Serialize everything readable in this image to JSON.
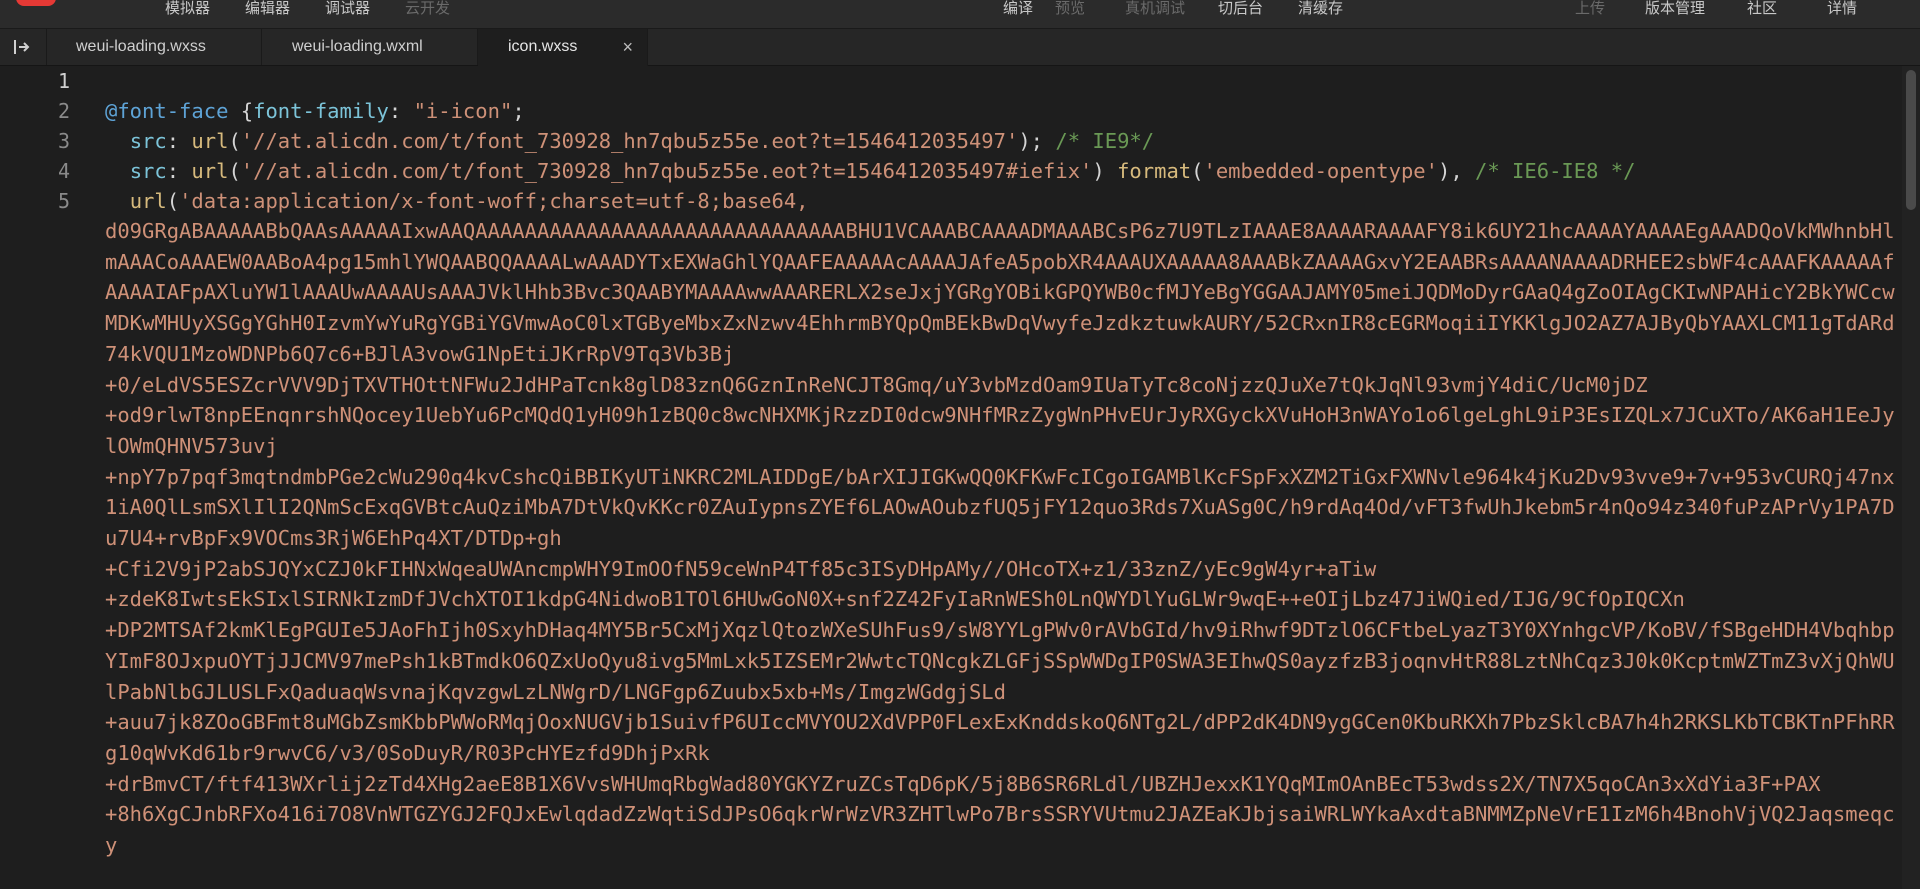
{
  "toolbar": {
    "simulator": "模拟器",
    "editor": "编辑器",
    "debugger": "调试器",
    "cloud_dev": "云开发",
    "compile": "编译",
    "preview": "预览",
    "remote_debug": "真机调试",
    "background": "切后台",
    "clear_cache": "清缓存",
    "upload": "上传",
    "version_mgmt": "版本管理",
    "community": "社区",
    "details": "详情"
  },
  "tabs": [
    {
      "label": "weui-loading.wxss"
    },
    {
      "label": "weui-loading.wxml"
    },
    {
      "label": "icon.wxss",
      "close": "×"
    }
  ],
  "gutter": [
    "1",
    "2",
    "3",
    "4",
    "5"
  ],
  "code": {
    "l2": {
      "at": "@font-face",
      "rest1": " {",
      "prop": "font-family",
      "rest2": ": ",
      "str": "\"i-icon\"",
      "end": ";"
    },
    "l3": {
      "indent": "  ",
      "prop": "src",
      "colon": ": ",
      "fn": "url",
      "open": "(",
      "str": "'//at.alicdn.com/t/font_730928_hn7qbu5z55e.eot?t=1546412035497'",
      "close": "); ",
      "cmt": "/* IE9*/"
    },
    "l4": {
      "indent": "  ",
      "prop": "src",
      "colon": ": ",
      "fn": "url",
      "open": "(",
      "str": "'//at.alicdn.com/t/font_730928_hn7qbu5z55e.eot?t=1546412035497#iefix'",
      "mid": ") ",
      "fn2": "format",
      "open2": "(",
      "str2": "'embedded-opentype'",
      "close2": "), ",
      "cmt": "/* IE6-IE8 */"
    },
    "l5": {
      "indent": "  ",
      "fn": "url",
      "open": "(",
      "str": "'data:application/x-font-woff;charset=utf-8;base64,"
    },
    "base64": "d09GRgABAAAAABbQAAsAAAAAIxwAAQAAAAAAAAAAAAAAAAAAAAAAAAAAAAAABHU1VCAAABCAAAADMAAABCsP6z7U9TLzIAAAE8AAAARAAAAFY8ik6UY21hcAAAAYAAAAEgAAADQoVkMWhnbHlmAAACoAAAEW0AABoA4pg15mhlYWQAABQQAAAALwAAADYTxEXWaGhlYQAAFEAAAAAcAAAAJAfeA5pobXR4AAAUXAAAAA8AAABkZAAAAGxvY2EAABRsAAAANAAAADRHEE2sbWF4cAAAFKAAAAAfAAAAIAFpAXluYW1lAAAUwAAAAUsAAAJVklHhb3Bvc3QAABYMAAAAwwAAARERLX2seJxjYGRgYOBikGPQYWB0cfMJYeBgYGGAAJAMY05meiJQDMoDyrGAaQ4gZoOIAgCKIwNPAHicY2BkYWCcwMDKwMHUyXSGgYGhH0IzvmYwYuRgYGBiYGVmwAoC0lxTGByeMbxZxNzwv4EhhrmBYQpQmBEkBwDqVwyfeJzdkztuwkAURY/52CRxnIR8cEGRMoqiiIYKKlgJO2AZ7AJByQbYAAXLCM11gTdARd74kVQU1MzoWDNPb6Q7c6+BJlA3vowG1NpEtiJKrRpV9Tq3Vb3Bj\n+0/eLdVS5ESZcrVVV9DjTXVTHOttNFWu2JdHPaTcnk8glD83znQ6GznInReNCJT8Gmq/uY3vbMzdOam9IUaTyTc8coNjzzQJuXe7tQkJqNl93vmjY4diC/UcM0jDZ\n+od9rlwT8npEEnqnrshNQocey1UebYu6PcMQdQ1yH09h1zBQ0c8wcNHXMKjRzzDI0dcw9NHfMRzZygWnPHvEUrJyRXGyckXVuHoH3nWAYo1o6lgeLghL9iP3EsIZQLx7JCuXTo/AK6aH1EeJylOWmQHNV573uvj\n+npY7p7pqf3mqtndmbPGe2cWu290q4kvCshcQiBBIKyUTiNKRC2MLAIDDgE/bArXIJIGKwQQ0KFKwFcICgoIGAMBlKcFSpFxXZM2TiGxFXWNvle964k4jKu2Dv93vve9+7v+953vCURQj47nx1iA0QlLsmSXlIlI2QNmScExqGVBtcAuQziMbA7DtVkQvKKcr0ZAuIypnsZYEf6LAOwAOubzfUQ5jFY12quo3Rds7XuASg0C/h9rdAq4Od/vFT3fwUhJkebm5r4nQo94z340fuPzAPrVy1PA7Du7U4+rvBpFx9VOCms3RjW6EhPq4XT/DTDp+gh\n+Cfi2V9jP2abSJQYxCZJ0kFIHNxWqeaUWAncmpWHY9ImOOfN59ceWnP4Tf85c3ISyDHpAMy//OHcoTX+z1/33znZ/yEc9gW4yr+aTiw\n+zdeK8IwtsEkSIxlSIRNkIzmDfJVchXTOI1kdpG4NidwoB1TOl6HUwGoN0X+snf2Z42FyIaRnWESh0LnQWYDlYuGLWr9wqE++eOIjLbz47JiWQied/IJG/9CfOpIQCXn\n+DP2MTSAf2kmKlEgPGUIe5JAoFhIjh0SxyhDHaq4MY5Br5CxMjXqzlQtozWXeSUhFus9/sW8YYLgPWv0rAVbGId/hv9iRhwf9DTzlO6CFtbeLyazT3Y0XYnhgcVP/KoBV/fSBgeHDH4VbqhbpYImF8OJxpuOYTjJJCMV97mePsh1kBTmdkO6QZxUoQyu8ivg5MmLxk5IZSEMr2WwtcTQNcgkZLGFjSSpWWDgIP0SWA3EIhwQS0ayzfzB3joqnvHtR88LztNhCqz3J0k0KcptmWZTmZ3vXjQhWUlPabNlbGJLUSLFxQaduaqWsvnajKqvzgwLzLNWgrD/LNGFgp6Zuubx5xb+Ms/ImgzWGdgjSLd\n+auu7jk8ZOoGBFmt8uMGbZsmKbbPWWoRMqjOoxNUGVjb1SuivfP6UIccMVYOU2XdVPP0FLexExKnddskoQ6NTg2L/dPP2dK4DN9ygGCen0KbuRKXh7PbzSklcBA7h4h2RKSLKbTCBKTnPFhRRg10qWvKd61br9rwvC6/v3/0SoDuyR/R03PcHYEzfd9DhjPxRk\n+drBmvCT/ftf413WXrlij2zTd4XHg2aeE8B1X6VvsWHUmqRbgWad80YGKYZruZCsTqD6pK/5j8B6SR6RLdl/UBZHJexxK1YQqMImOAnBEcT53wdss2X/TN7X5qoCAn3xXdYia3F+PAX\n+8h6XgCJnbRFXo416i7O8VnWTGZYGJ2FQJxEwlqdadZzWqtiSdJPsO6qkrWrWzVR3ZHTlwPo7BrsSSRYVUtmu2JAZEaKJbjsaiWRLWYkaAxdtaBNMMZpNeVrE1IzM6h4BnohVjVQ2Jaqsmeqcy"
  }
}
